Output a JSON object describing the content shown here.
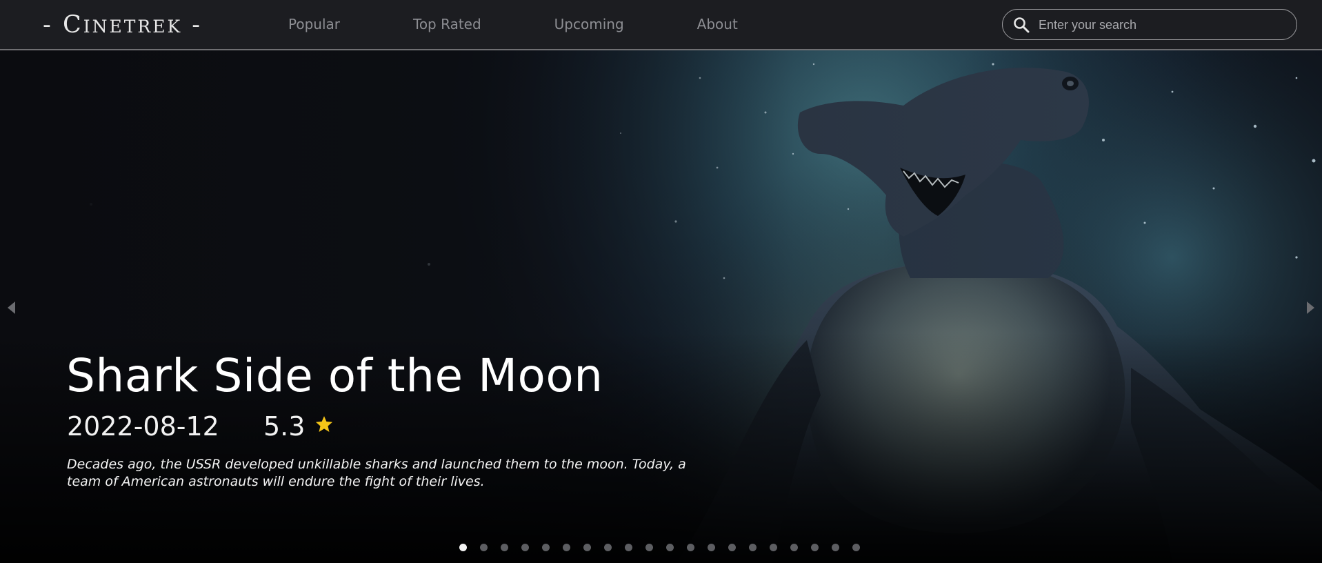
{
  "brand": {
    "logo_text": "- Cinetrek -"
  },
  "nav": {
    "links": [
      {
        "label": "Popular"
      },
      {
        "label": "Top Rated"
      },
      {
        "label": "Upcoming"
      },
      {
        "label": "About"
      }
    ]
  },
  "search": {
    "placeholder": "Enter your search",
    "value": "",
    "icon": "search-icon"
  },
  "hero": {
    "title": "Shark Side of the Moon",
    "release_date": "2022-08-12",
    "rating": "5.3",
    "rating_icon": "star-icon",
    "description": "Decades ago, the USSR developed unkillable sharks and launched them to the moon. Today, a team of American astronauts will endure the fight of their lives.",
    "prev_icon": "caret-left-icon",
    "next_icon": "caret-right-icon"
  },
  "carousel": {
    "total_slides": 20,
    "active_index": 0
  },
  "colors": {
    "navbar_bg": "#1c1d21",
    "nav_link": "#8d8e93",
    "star": "#f5c518",
    "dot_inactive": "#5d5e62",
    "dot_active": "#f3f3f3"
  }
}
